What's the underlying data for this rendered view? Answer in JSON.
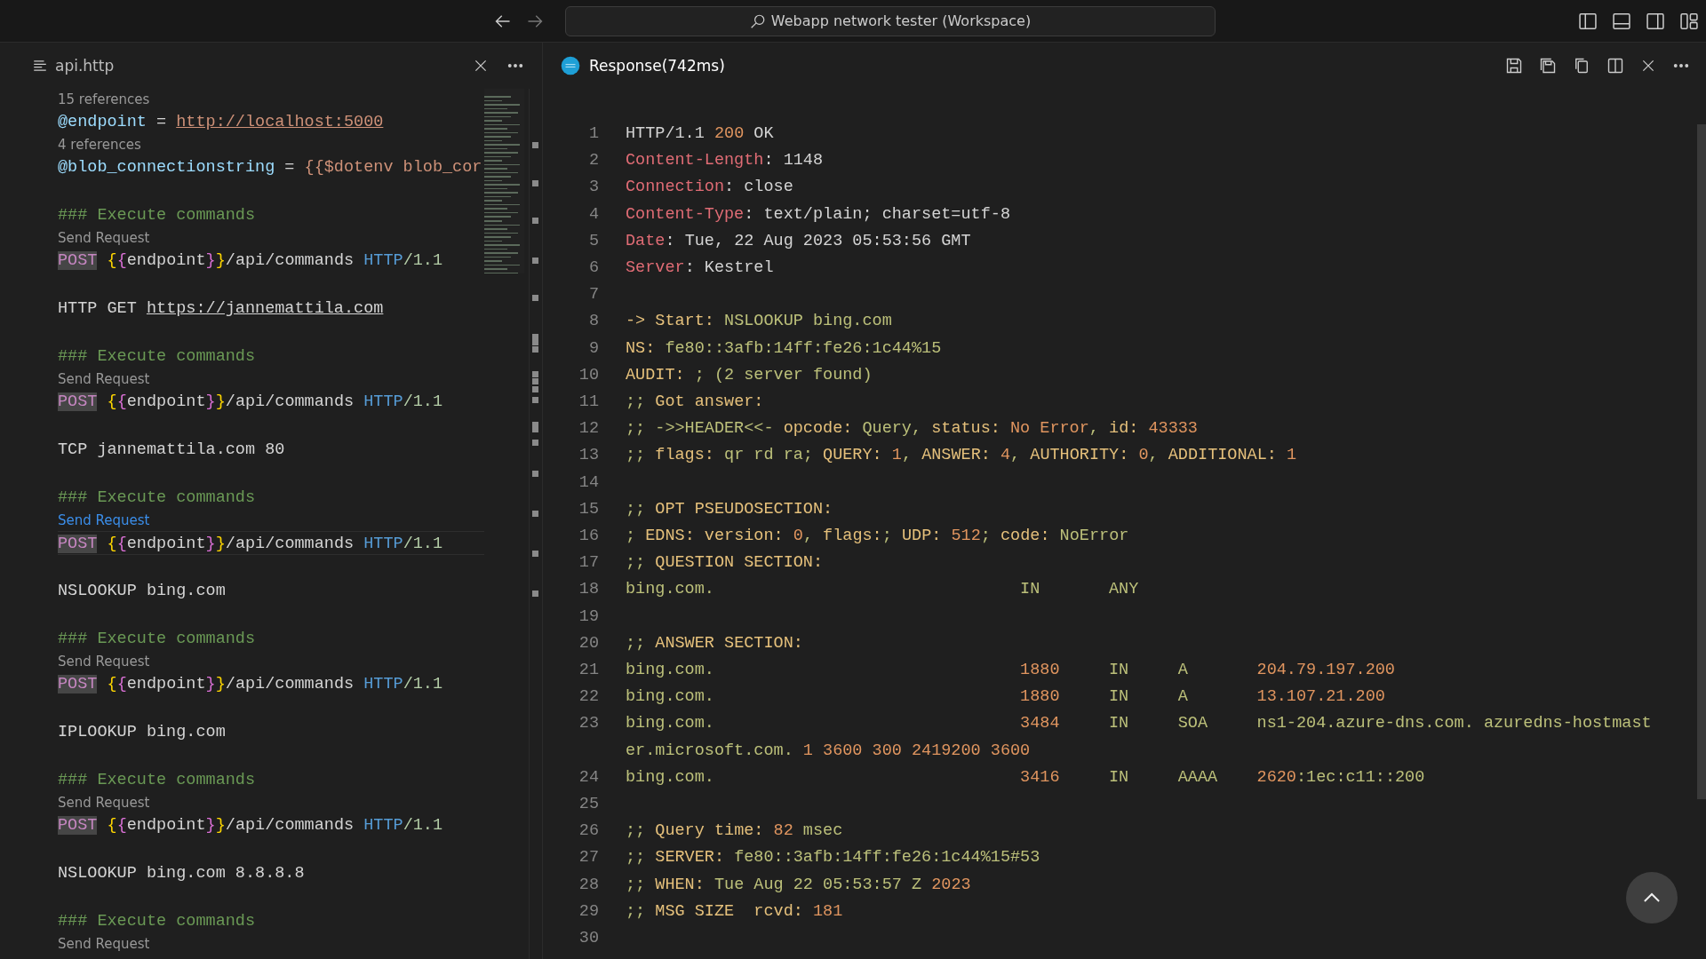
{
  "titlebar": {
    "search": "Webapp network tester (Workspace)"
  },
  "left_editor": {
    "tab": {
      "label": "api.http"
    },
    "lines": [
      {
        "kind": "lens",
        "text": "15 references",
        "active": false
      },
      {
        "kind": "code",
        "current": false,
        "tokens": [
          {
            "t": "@endpoint",
            "kind": "var"
          },
          {
            "t": " = ",
            "kind": "plain"
          },
          {
            "t": "http://localhost:5000",
            "kind": "url"
          }
        ]
      },
      {
        "kind": "lens",
        "text": "4 references",
        "active": false
      },
      {
        "kind": "code",
        "current": false,
        "tokens": [
          {
            "t": "@blob_connectionstring",
            "kind": "var"
          },
          {
            "t": " = ",
            "kind": "plain"
          },
          {
            "t": "{{$dotenv blob_cor",
            "kind": "str"
          }
        ]
      },
      {
        "kind": "blank"
      },
      {
        "kind": "code",
        "current": false,
        "tokens": [
          {
            "t": "### Execute commands",
            "kind": "comment"
          }
        ]
      },
      {
        "kind": "lens",
        "text": "Send Request",
        "active": false
      },
      {
        "kind": "code",
        "current": false,
        "tokens": [
          {
            "t": "POST",
            "kind": "method"
          },
          {
            "t": " {",
            "kind": "brace1"
          },
          {
            "t": "{",
            "kind": "brace2"
          },
          {
            "t": "endpoint",
            "kind": "plain"
          },
          {
            "t": "}",
            "kind": "brace2"
          },
          {
            "t": "}",
            "kind": "brace1"
          },
          {
            "t": "/api/commands ",
            "kind": "plain"
          },
          {
            "t": "HTTP",
            "kind": "proto"
          },
          {
            "t": "/1.1",
            "kind": "version"
          }
        ]
      },
      {
        "kind": "blank"
      },
      {
        "kind": "code",
        "current": false,
        "tokens": [
          {
            "t": "HTTP GET ",
            "kind": "plain"
          },
          {
            "t": "https://jannemattila.com",
            "kind": "link"
          }
        ]
      },
      {
        "kind": "blank"
      },
      {
        "kind": "code",
        "current": false,
        "tokens": [
          {
            "t": "### Execute commands",
            "kind": "comment"
          }
        ]
      },
      {
        "kind": "lens",
        "text": "Send Request",
        "active": false
      },
      {
        "kind": "code",
        "current": false,
        "tokens": [
          {
            "t": "POST",
            "kind": "method"
          },
          {
            "t": " {",
            "kind": "brace1"
          },
          {
            "t": "{",
            "kind": "brace2"
          },
          {
            "t": "endpoint",
            "kind": "plain"
          },
          {
            "t": "}",
            "kind": "brace2"
          },
          {
            "t": "}",
            "kind": "brace1"
          },
          {
            "t": "/api/commands ",
            "kind": "plain"
          },
          {
            "t": "HTTP",
            "kind": "proto"
          },
          {
            "t": "/1.1",
            "kind": "version"
          }
        ]
      },
      {
        "kind": "blank"
      },
      {
        "kind": "code",
        "current": false,
        "tokens": [
          {
            "t": "TCP jannemattila.com 80",
            "kind": "plain"
          }
        ]
      },
      {
        "kind": "blank"
      },
      {
        "kind": "code",
        "current": false,
        "tokens": [
          {
            "t": "### Execute commands",
            "kind": "comment"
          }
        ]
      },
      {
        "kind": "lens",
        "text": "Send Request",
        "active": true
      },
      {
        "kind": "code",
        "current": true,
        "tokens": [
          {
            "t": "POST",
            "kind": "method"
          },
          {
            "t": " {",
            "kind": "brace1"
          },
          {
            "t": "{",
            "kind": "brace2"
          },
          {
            "t": "endpoint",
            "kind": "plain"
          },
          {
            "t": "}",
            "kind": "brace2"
          },
          {
            "t": "}",
            "kind": "brace1"
          },
          {
            "t": "/api/commands ",
            "kind": "plain"
          },
          {
            "t": "HTTP",
            "kind": "proto"
          },
          {
            "t": "/1.1",
            "kind": "version"
          }
        ]
      },
      {
        "kind": "blank"
      },
      {
        "kind": "code",
        "current": false,
        "tokens": [
          {
            "t": "NSLOOKUP bing.com",
            "kind": "plain"
          }
        ]
      },
      {
        "kind": "blank"
      },
      {
        "kind": "code",
        "current": false,
        "tokens": [
          {
            "t": "### Execute commands",
            "kind": "comment"
          }
        ]
      },
      {
        "kind": "lens",
        "text": "Send Request",
        "active": false
      },
      {
        "kind": "code",
        "current": false,
        "tokens": [
          {
            "t": "POST",
            "kind": "method"
          },
          {
            "t": " {",
            "kind": "brace1"
          },
          {
            "t": "{",
            "kind": "brace2"
          },
          {
            "t": "endpoint",
            "kind": "plain"
          },
          {
            "t": "}",
            "kind": "brace2"
          },
          {
            "t": "}",
            "kind": "brace1"
          },
          {
            "t": "/api/commands ",
            "kind": "plain"
          },
          {
            "t": "HTTP",
            "kind": "proto"
          },
          {
            "t": "/1.1",
            "kind": "version"
          }
        ]
      },
      {
        "kind": "blank"
      },
      {
        "kind": "code",
        "current": false,
        "tokens": [
          {
            "t": "IPLOOKUP bing.com",
            "kind": "plain"
          }
        ]
      },
      {
        "kind": "blank"
      },
      {
        "kind": "code",
        "current": false,
        "tokens": [
          {
            "t": "### Execute commands",
            "kind": "comment"
          }
        ]
      },
      {
        "kind": "lens",
        "text": "Send Request",
        "active": false
      },
      {
        "kind": "code",
        "current": false,
        "tokens": [
          {
            "t": "POST",
            "kind": "method"
          },
          {
            "t": " {",
            "kind": "brace1"
          },
          {
            "t": "{",
            "kind": "brace2"
          },
          {
            "t": "endpoint",
            "kind": "plain"
          },
          {
            "t": "}",
            "kind": "brace2"
          },
          {
            "t": "}",
            "kind": "brace1"
          },
          {
            "t": "/api/commands ",
            "kind": "plain"
          },
          {
            "t": "HTTP",
            "kind": "proto"
          },
          {
            "t": "/1.1",
            "kind": "version"
          }
        ]
      },
      {
        "kind": "blank"
      },
      {
        "kind": "code",
        "current": false,
        "tokens": [
          {
            "t": "NSLOOKUP bing.com 8.8.8.8",
            "kind": "plain"
          }
        ]
      },
      {
        "kind": "blank"
      },
      {
        "kind": "code",
        "current": false,
        "tokens": [
          {
            "t": "### Execute commands",
            "kind": "comment"
          }
        ]
      },
      {
        "kind": "lens",
        "text": "Send Request",
        "active": false
      }
    ]
  },
  "response": {
    "tab": {
      "label": "Response(742ms)"
    },
    "lines": [
      {
        "n": "1",
        "tokens": [
          {
            "t": "HTTP/1.1 ",
            "kind": "plain"
          },
          {
            "t": "200",
            "kind": "num"
          },
          {
            "t": " OK",
            "kind": "plain"
          }
        ]
      },
      {
        "n": "2",
        "tokens": [
          {
            "t": "Content-Length",
            "kind": "key"
          },
          {
            "t": ": 1148",
            "kind": "plain"
          }
        ]
      },
      {
        "n": "3",
        "tokens": [
          {
            "t": "Connection",
            "kind": "key"
          },
          {
            "t": ": close",
            "kind": "plain"
          }
        ]
      },
      {
        "n": "4",
        "tokens": [
          {
            "t": "Content-Type",
            "kind": "key"
          },
          {
            "t": ": text/plain; charset=utf-8",
            "kind": "plain"
          }
        ]
      },
      {
        "n": "5",
        "tokens": [
          {
            "t": "Date",
            "kind": "key"
          },
          {
            "t": ": Tue, 22 Aug 2023 05:53:56 GMT",
            "kind": "plain"
          }
        ]
      },
      {
        "n": "6",
        "tokens": [
          {
            "t": "Server",
            "kind": "key"
          },
          {
            "t": ": Kestrel",
            "kind": "plain"
          }
        ]
      },
      {
        "n": "7"
      },
      {
        "n": "8",
        "tokens": [
          {
            "t": "-> Start:",
            "kind": "label"
          },
          {
            "t": " NSLOOKUP bing.com",
            "kind": "str"
          }
        ]
      },
      {
        "n": "9",
        "tokens": [
          {
            "t": "NS:",
            "kind": "label"
          },
          {
            "t": " fe80::3afb:14ff:fe26:1c44%15",
            "kind": "str"
          }
        ]
      },
      {
        "n": "10",
        "tokens": [
          {
            "t": "AUDIT:",
            "kind": "label"
          },
          {
            "t": " ; (2 server found)",
            "kind": "str"
          }
        ]
      },
      {
        "n": "11",
        "tokens": [
          {
            "t": ";; ",
            "kind": "str"
          },
          {
            "t": "Got answer:",
            "kind": "label"
          }
        ]
      },
      {
        "n": "12",
        "tokens": [
          {
            "t": ";; ->>HEADER<<- ",
            "kind": "str"
          },
          {
            "t": "opcode:",
            "kind": "label"
          },
          {
            "t": " Query, ",
            "kind": "str"
          },
          {
            "t": "status:",
            "kind": "label"
          },
          {
            "t": " No Error",
            "kind": "num"
          },
          {
            "t": ", ",
            "kind": "str"
          },
          {
            "t": "id:",
            "kind": "label"
          },
          {
            "t": " 43333",
            "kind": "num"
          }
        ]
      },
      {
        "n": "13",
        "tokens": [
          {
            "t": ";; ",
            "kind": "str"
          },
          {
            "t": "flags:",
            "kind": "label"
          },
          {
            "t": " qr rd ra; ",
            "kind": "str"
          },
          {
            "t": "QUERY:",
            "kind": "label"
          },
          {
            "t": " 1",
            "kind": "num"
          },
          {
            "t": ", ",
            "kind": "str"
          },
          {
            "t": "ANSWER:",
            "kind": "label"
          },
          {
            "t": " 4",
            "kind": "num"
          },
          {
            "t": ", ",
            "kind": "str"
          },
          {
            "t": "AUTHORITY:",
            "kind": "label"
          },
          {
            "t": " 0",
            "kind": "num"
          },
          {
            "t": ", ",
            "kind": "str"
          },
          {
            "t": "ADDITIONAL:",
            "kind": "label"
          },
          {
            "t": " 1",
            "kind": "num"
          }
        ]
      },
      {
        "n": "14"
      },
      {
        "n": "15",
        "tokens": [
          {
            "t": ";; ",
            "kind": "str"
          },
          {
            "t": "OPT PSEUDOSECTION:",
            "kind": "label"
          }
        ]
      },
      {
        "n": "16",
        "tokens": [
          {
            "t": "; ",
            "kind": "str"
          },
          {
            "t": "EDNS: version:",
            "kind": "label"
          },
          {
            "t": " 0",
            "kind": "num"
          },
          {
            "t": ", ",
            "kind": "str"
          },
          {
            "t": "flags:",
            "kind": "label"
          },
          {
            "t": "; ",
            "kind": "str"
          },
          {
            "t": "UDP:",
            "kind": "label"
          },
          {
            "t": " 512",
            "kind": "num"
          },
          {
            "t": "; ",
            "kind": "str"
          },
          {
            "t": "code:",
            "kind": "label"
          },
          {
            "t": " NoError",
            "kind": "str"
          }
        ]
      },
      {
        "n": "17",
        "tokens": [
          {
            "t": ";; ",
            "kind": "str"
          },
          {
            "t": "QUESTION SECTION:",
            "kind": "label"
          }
        ]
      },
      {
        "n": "18",
        "tokens": [
          {
            "t": "bing.com.                               IN       ANY",
            "kind": "str"
          }
        ]
      },
      {
        "n": "19"
      },
      {
        "n": "20",
        "tokens": [
          {
            "t": ";; ",
            "kind": "str"
          },
          {
            "t": "ANSWER SECTION:",
            "kind": "label"
          }
        ]
      },
      {
        "n": "21",
        "tokens": [
          {
            "t": "bing.com.                               ",
            "kind": "str"
          },
          {
            "t": "1880",
            "kind": "num"
          },
          {
            "t": "     IN     A       ",
            "kind": "str"
          },
          {
            "t": "204.79.197.200",
            "kind": "num"
          }
        ]
      },
      {
        "n": "22",
        "tokens": [
          {
            "t": "bing.com.                               ",
            "kind": "str"
          },
          {
            "t": "1880",
            "kind": "num"
          },
          {
            "t": "     IN     A       ",
            "kind": "str"
          },
          {
            "t": "13.107.21.200",
            "kind": "num"
          }
        ]
      },
      {
        "n": "23",
        "tokens": [
          {
            "t": "bing.com.                               ",
            "kind": "str"
          },
          {
            "t": "3484",
            "kind": "num"
          },
          {
            "t": "     IN     SOA     ns1-204.azure-dns.com. azuredns-hostmaster.microsoft.com. ",
            "kind": "str"
          },
          {
            "t": "1 3600 300 2419200 3600",
            "kind": "num"
          }
        ]
      },
      {
        "n": "24",
        "tokens": [
          {
            "t": "bing.com.                               ",
            "kind": "str"
          },
          {
            "t": "3416",
            "kind": "num"
          },
          {
            "t": "     IN     AAAA    ",
            "kind": "str"
          },
          {
            "t": "2620",
            "kind": "num"
          },
          {
            "t": ":1ec:c11::200",
            "kind": "str"
          }
        ]
      },
      {
        "n": "25"
      },
      {
        "n": "26",
        "tokens": [
          {
            "t": ";; ",
            "kind": "str"
          },
          {
            "t": "Query time:",
            "kind": "label"
          },
          {
            "t": " 82",
            "kind": "num"
          },
          {
            "t": " msec",
            "kind": "str"
          }
        ]
      },
      {
        "n": "27",
        "tokens": [
          {
            "t": ";; ",
            "kind": "str"
          },
          {
            "t": "SERVER:",
            "kind": "label"
          },
          {
            "t": " fe80::3afb:14ff:fe26:1c44%15#53",
            "kind": "str"
          }
        ]
      },
      {
        "n": "28",
        "tokens": [
          {
            "t": ";; ",
            "kind": "str"
          },
          {
            "t": "WHEN:",
            "kind": "label"
          },
          {
            "t": " Tue Aug 22 05:53:57 Z ",
            "kind": "str"
          },
          {
            "t": "2023",
            "kind": "num"
          }
        ]
      },
      {
        "n": "29",
        "tokens": [
          {
            "t": ";; ",
            "kind": "str"
          },
          {
            "t": "MSG SIZE  rcvd:",
            "kind": "label"
          },
          {
            "t": " 181",
            "kind": "num"
          }
        ]
      },
      {
        "n": "30"
      }
    ]
  }
}
